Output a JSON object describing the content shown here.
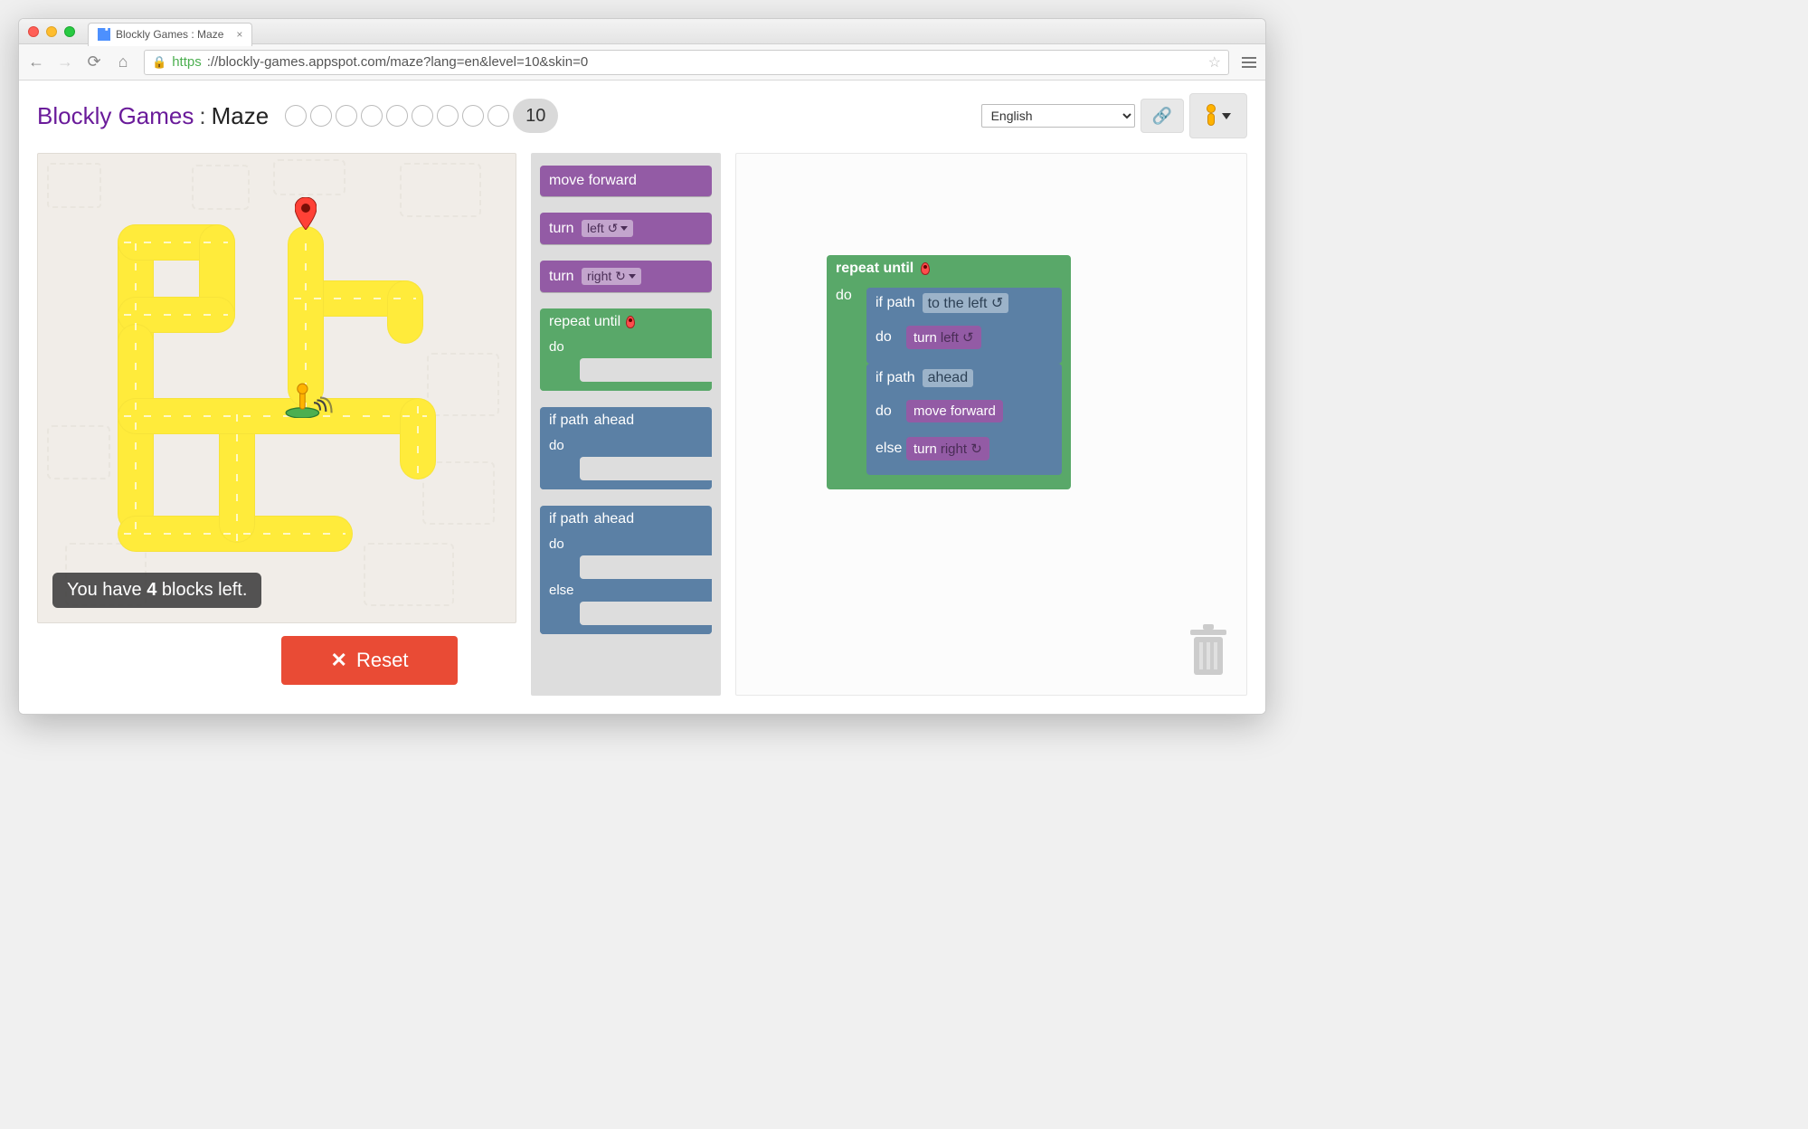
{
  "browser": {
    "tab_title": "Blockly Games : Maze",
    "url_https": "https",
    "url_rest": "://blockly-games.appspot.com/maze?lang=en&level=10&skin=0"
  },
  "header": {
    "title_link": "Blockly Games",
    "title_sep": " : ",
    "title_game": "Maze",
    "current_level": "10",
    "language": "English"
  },
  "toolbox": {
    "move_forward": "move forward",
    "turn": "turn",
    "left_opt": "left ↺",
    "right_opt": "right ↻",
    "repeat_until": "repeat until",
    "do": "do",
    "if_path": "if path",
    "ahead_opt": "ahead",
    "else": "else"
  },
  "workspace": {
    "repeat_until": "repeat until",
    "do": "do",
    "if_path": "if path",
    "to_left_opt": "to the left ↺",
    "turn": "turn",
    "left_opt": "left ↺",
    "ahead_opt": "ahead",
    "move_forward": "move forward",
    "else": "else",
    "right_opt": "right ↻"
  },
  "capacity": {
    "pre": "You have ",
    "count": "4",
    "post": " blocks left."
  },
  "reset_label": "Reset"
}
